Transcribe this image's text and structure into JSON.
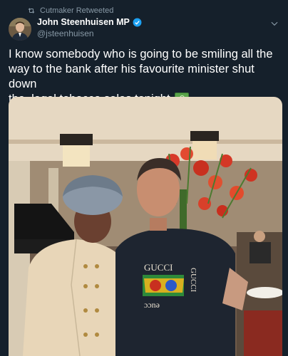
{
  "retweet": {
    "label": "Cutmaker Retweeted",
    "icon": "retweet-icon"
  },
  "author": {
    "display_name": "John Steenhuisen MP",
    "handle": "@jsteenhuisen",
    "verified_icon": "verified-badge-icon"
  },
  "tweet": {
    "text_line1": "I know somebody who is going to be smiling all the",
    "text_line2": "way to the bank after his favourite minister shut down",
    "text_line3": "the  legal tobacco sales tonight",
    "emoji": "money-banknote-icon"
  },
  "photo": {
    "shirt_text_top": "GUCCI",
    "shirt_text_bottom": "ɔɔnә",
    "shirt_text_side": "GUCCI"
  },
  "colors": {
    "background": "#15202b",
    "secondary_text": "#8899a6",
    "verified_blue": "#1da1f2"
  }
}
